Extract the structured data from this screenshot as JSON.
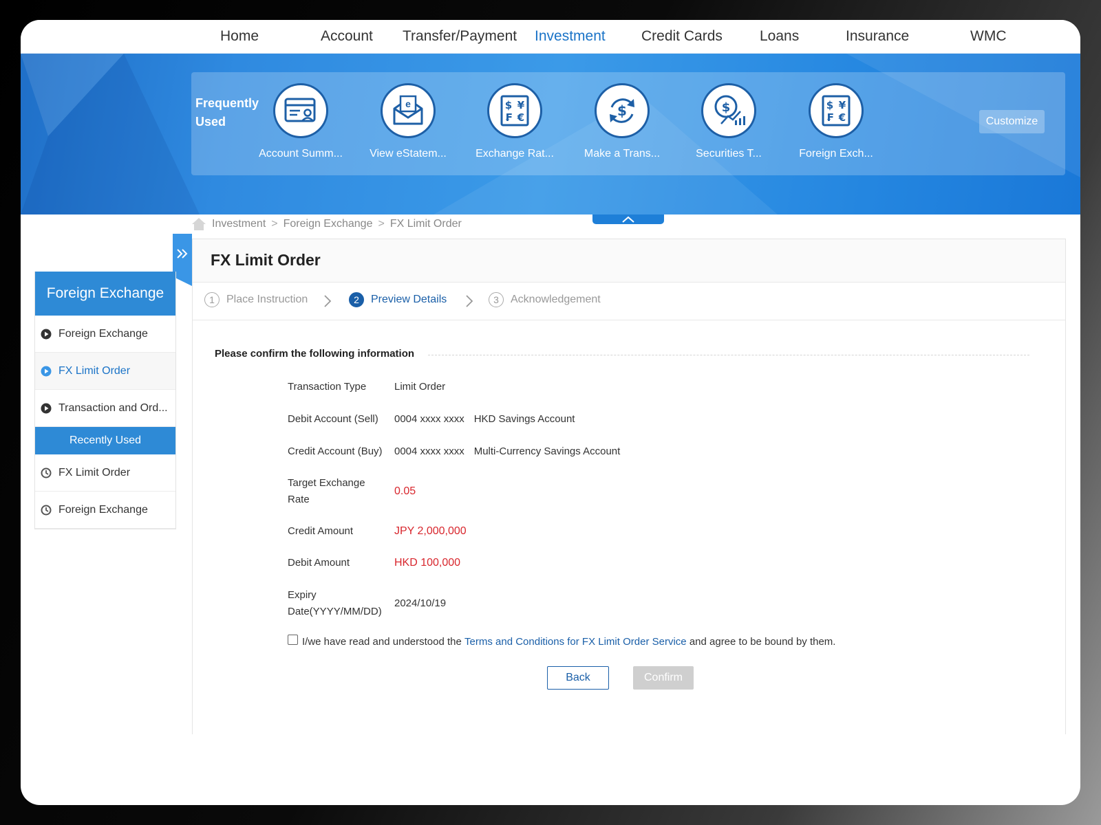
{
  "nav": {
    "items": [
      "Home",
      "Account",
      "Transfer/Payment",
      "Investment",
      "Credit Cards",
      "Loans",
      "Insurance",
      "WMC"
    ],
    "active": "Investment"
  },
  "frequently_used": {
    "title": "Frequently Used",
    "items": [
      {
        "label": "Account Summ...",
        "icon": "account-summary-icon"
      },
      {
        "label": "View eStatem...",
        "icon": "estatement-icon"
      },
      {
        "label": "Exchange Rat...",
        "icon": "exchange-rate-icon"
      },
      {
        "label": "Make a Trans...",
        "icon": "transfer-icon"
      },
      {
        "label": "Securities T...",
        "icon": "securities-icon"
      },
      {
        "label": "Foreign Exch...",
        "icon": "foreign-exchange-icon"
      }
    ],
    "customize_label": "Customize"
  },
  "breadcrumb": [
    "Investment",
    "Foreign Exchange",
    "FX Limit Order"
  ],
  "sidebar": {
    "title": "Foreign Exchange",
    "items": [
      {
        "label": "Foreign Exchange",
        "active": false
      },
      {
        "label": "FX Limit Order",
        "active": true
      },
      {
        "label": "Transaction and Ord...",
        "active": false
      }
    ],
    "recent_title": "Recently Used",
    "recent_items": [
      "FX Limit Order",
      "Foreign Exchange"
    ]
  },
  "page": {
    "title": "FX Limit Order",
    "steps": [
      {
        "num": "1",
        "label": "Place Instruction"
      },
      {
        "num": "2",
        "label": "Preview Details"
      },
      {
        "num": "3",
        "label": "Acknowledgement"
      }
    ],
    "active_step": 2,
    "section_title": "Please confirm the following information"
  },
  "details": {
    "transaction_type": {
      "label": "Transaction Type",
      "value": "Limit Order"
    },
    "debit_account": {
      "label": "Debit Account (Sell)",
      "number": "0004 xxxx xxxx",
      "name": "HKD Savings Account"
    },
    "credit_account": {
      "label": "Credit Account (Buy)",
      "number": "0004 xxxx xxxx",
      "name": "Multi-Currency Savings Account"
    },
    "target_rate": {
      "label": "Target Exchange Rate",
      "value": "0.05"
    },
    "credit_amount": {
      "label": "Credit Amount",
      "value": "JPY 2,000,000"
    },
    "debit_amount": {
      "label": "Debit Amount",
      "value": "HKD 100,000"
    },
    "expiry_date": {
      "label": "Expiry Date(YYYY/MM/DD)",
      "value": "2024/10/19"
    }
  },
  "terms": {
    "prefix": "I/we have read and understood the",
    "link": "Terms and Conditions for FX Limit Order Service",
    "suffix": "and agree to be bound by them.",
    "checked": false
  },
  "buttons": {
    "back": "Back",
    "confirm": "Confirm"
  },
  "colors": {
    "accent": "#1a73c7",
    "amount_red": "#d8262d",
    "sidebar_blue": "#2e8ad6"
  }
}
